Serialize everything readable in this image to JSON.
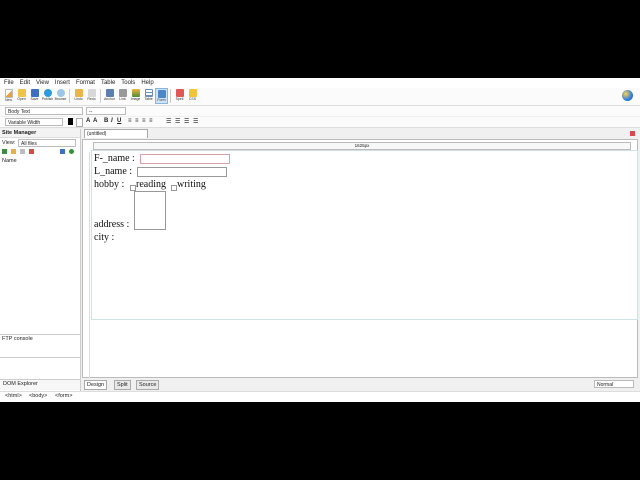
{
  "menu": [
    "File",
    "Edit",
    "View",
    "Insert",
    "Format",
    "Table",
    "Tools",
    "Help"
  ],
  "toolbar": [
    {
      "label": "New",
      "icon": "new-icon"
    },
    {
      "label": "Open",
      "icon": "open-icon"
    },
    {
      "label": "Save",
      "icon": "save-icon"
    },
    {
      "label": "Publish",
      "icon": "publish-icon"
    },
    {
      "label": "Browse",
      "icon": "browse-icon"
    },
    {
      "label": "Undo",
      "icon": "undo-icon"
    },
    {
      "label": "Redo",
      "icon": "redo-icon"
    },
    {
      "label": "Anchor",
      "icon": "anchor-icon"
    },
    {
      "label": "Link",
      "icon": "link-icon"
    },
    {
      "label": "Image",
      "icon": "image-icon"
    },
    {
      "label": "Table",
      "icon": "table-icon"
    },
    {
      "label": "Form",
      "icon": "form-icon"
    },
    {
      "label": "Spell",
      "icon": "spell-icon"
    },
    {
      "label": "CSS",
      "icon": "css-icon"
    }
  ],
  "format": {
    "paragraph": "Body Text",
    "font": "Variable Width",
    "bold": "B",
    "italic": "I",
    "underline": "U"
  },
  "sidebar": {
    "title": "Site Manager",
    "view_label": "View:",
    "view_value": "All files",
    "column": "Name",
    "ftp": "FTP console",
    "dom": "DOM Explorer"
  },
  "editor": {
    "tab": "(untitled)",
    "ruler": "1625px",
    "form": {
      "fname": "F-_name :",
      "lname": "L_name :",
      "hobby": "hobby :",
      "reading": "reading",
      "writing": "writing",
      "address": "address :",
      "city": "city :"
    }
  },
  "bottom": {
    "design": "Design",
    "split": "Split",
    "source": "Source",
    "mode": "Normal"
  },
  "status": [
    "<html>",
    "<body>",
    "<form>"
  ]
}
